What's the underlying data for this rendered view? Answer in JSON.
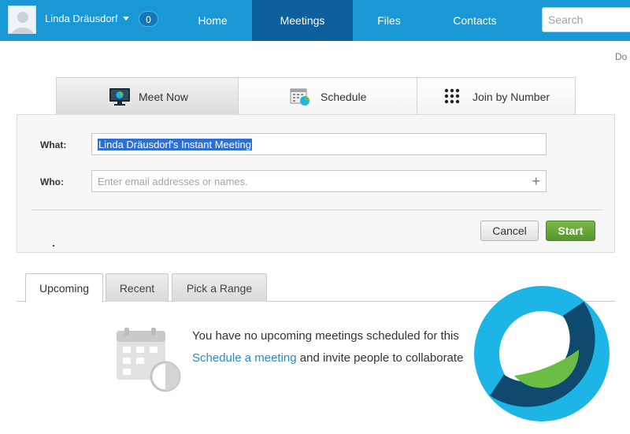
{
  "header": {
    "user_name": "Linda Dräusdorf",
    "badge_count": "0",
    "nav": {
      "home": "Home",
      "meetings": "Meetings",
      "files": "Files",
      "contacts": "Contacts"
    },
    "search_placeholder": "Search",
    "colors": {
      "bar": "#1a98d5",
      "active_tab": "#0d5f9e"
    }
  },
  "page_cut_text": "Do",
  "top_tabs": {
    "meet_now": "Meet Now",
    "schedule": "Schedule",
    "join_by_number": "Join by Number"
  },
  "form": {
    "what_label": "What:",
    "what_value": "Linda Dräusdorf's Instant Meeting",
    "who_label": "Who:",
    "who_placeholder": "Enter email addresses or names.",
    "add_icon": "+",
    "cancel_label": "Cancel",
    "start_label": "Start",
    "colors": {
      "start": "#6aa83a"
    }
  },
  "lower_tabs": {
    "upcoming": "Upcoming",
    "recent": "Recent",
    "pick_a_range": "Pick a Range"
  },
  "empty_state": {
    "line1": "You have no upcoming meetings scheduled for this",
    "link": "Schedule a meeting",
    "line2_rest": " and invite people to collaborate",
    "icon": "calendar-clock-icon"
  },
  "logo": {
    "icon": "webex-logo",
    "colors": [
      "#1cb5e6",
      "#0f4a6e",
      "#6cbd45"
    ]
  }
}
